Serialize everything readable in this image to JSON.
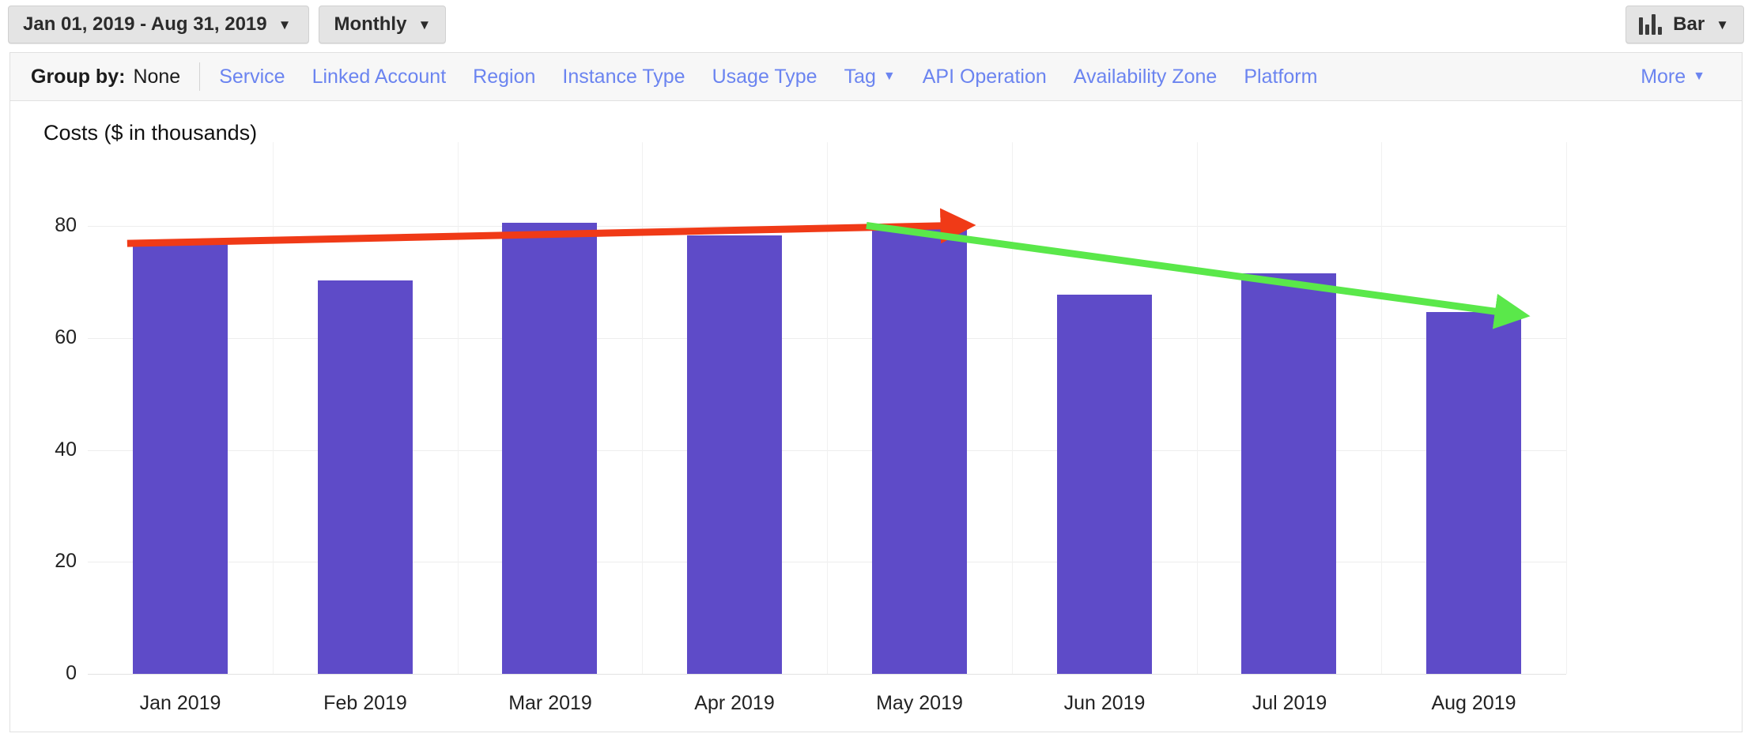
{
  "toolbar": {
    "date_range": "Jan 01, 2019 - Aug 31, 2019",
    "granularity": "Monthly",
    "viz_type": "Bar",
    "caret": "▼"
  },
  "groupby": {
    "label": "Group by:",
    "value": "None",
    "links": [
      {
        "label": "Service",
        "has_caret": false
      },
      {
        "label": "Linked Account",
        "has_caret": false
      },
      {
        "label": "Region",
        "has_caret": false
      },
      {
        "label": "Instance Type",
        "has_caret": false
      },
      {
        "label": "Usage Type",
        "has_caret": false
      },
      {
        "label": "Tag",
        "has_caret": true
      },
      {
        "label": "API Operation",
        "has_caret": false
      },
      {
        "label": "Availability Zone",
        "has_caret": false
      },
      {
        "label": "Platform",
        "has_caret": false
      }
    ],
    "more": "More",
    "caret": "▼"
  },
  "colors": {
    "bar": "#5e4bc8",
    "link": "#6b84f0",
    "trend_up": "#f03a17",
    "trend_down": "#5ae84a",
    "toolbar_button": "#e4e4e4",
    "panel_bg": "#ffffff"
  },
  "chart_data": {
    "type": "bar",
    "title": "Costs ($ in thousands)",
    "xlabel": "",
    "ylabel": "",
    "grid": true,
    "legend": "none",
    "ylim": [
      0,
      95
    ],
    "yticks": [
      0,
      20,
      40,
      60,
      80
    ],
    "categories": [
      "Jan 2019",
      "Feb 2019",
      "Mar 2019",
      "Apr 2019",
      "May 2019",
      "Jun 2019",
      "Jul 2019",
      "Aug 2019"
    ],
    "values": [
      77.2,
      70.3,
      80.6,
      78.4,
      80.4,
      67.8,
      71.6,
      64.6
    ],
    "annotations": [
      {
        "name": "rising-trend-arrow",
        "color": "#f03a17",
        "from": {
          "category": "Jan 2019",
          "value": 77.2
        },
        "to": {
          "category": "May 2019",
          "value": 80.4
        },
        "direction": "up"
      },
      {
        "name": "falling-trend-arrow",
        "color": "#5ae84a",
        "from": {
          "category": "May 2019",
          "value": 80.4
        },
        "to": {
          "category": "Aug 2019",
          "value": 64.6
        },
        "direction": "down"
      }
    ]
  }
}
